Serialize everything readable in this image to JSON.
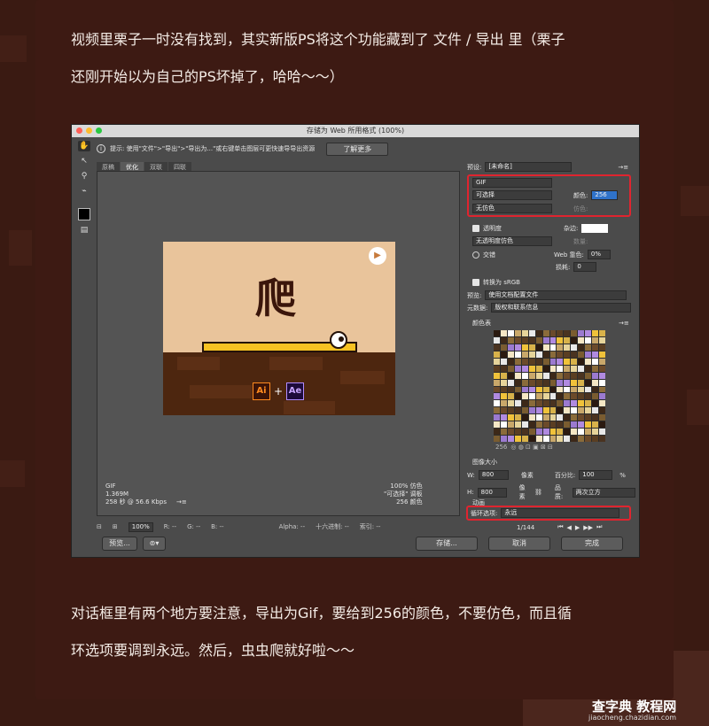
{
  "article": {
    "intro_line1": "视频里栗子一时没有找到，其实新版PS将这个功能藏到了 文件 / 导出 里（栗子",
    "intro_line2": "还刚开始以为自己的PS坏掉了，哈哈～～）",
    "outro_line1": "对话框里有两个地方要注意，导出为Gif，要给到256的颜色，不要仿色，而且循",
    "outro_line2": "环选项要调到永远。然后，虫虫爬就好啦～～"
  },
  "dialog": {
    "title": "存储为 Web 所用格式 (100%)",
    "tip": "提示: 使用\"文件\">\"导出\">\"导出为...\"或右键单击图层可更快速导导出资源",
    "learn_more": "了解更多",
    "view_tabs": [
      "原稿",
      "优化",
      "双联",
      "四联"
    ],
    "active_tab_index": 1,
    "preview": {
      "character": "爬",
      "logo_ai": "Ai",
      "logo_ae": "Ae",
      "plus": "+"
    },
    "stats_left": [
      "GIF",
      "1.369M",
      "258 秒 @ 56.6 Kbps",
      "→≡"
    ],
    "stats_right": [
      "100% 仿色",
      "\"可选择\" 调板",
      "256 颜色"
    ],
    "statusbar": [
      "100%",
      "R: --",
      "G: --",
      "B: --",
      "Alpha: --",
      "十六进制: --",
      "索引: --"
    ],
    "buttons": {
      "preview": "预览...",
      "save": "存储...",
      "cancel": "取消",
      "done": "完成"
    }
  },
  "settings": {
    "preset_label": "预设:",
    "preset_value": "[未命名]",
    "format": "GIF",
    "reduction": "可选择",
    "colors_label": "颜色:",
    "colors_value": "256",
    "dither": "无仿色",
    "dither_label": "仿色:",
    "transparency_label": "透明度",
    "matte_label": "杂边:",
    "transparency_dither": "无透明度仿色",
    "amount_label": "数量:",
    "interlaced_label": "交错",
    "web_snap_label": "Web 靠色:",
    "web_snap_value": "0%",
    "lossy_label": "损耗:",
    "lossy_value": "0",
    "convert_srgb": "转换为 sRGB",
    "preview_label": "预览:",
    "preview_value": "使用文档配置文件",
    "metadata_label": "元数据:",
    "metadata_value": "版权和联系信息",
    "color_table_label": "颜色表",
    "color_count": "256",
    "image_size_label": "图像大小",
    "w_label": "W:",
    "w_value": "800",
    "h_label": "H:",
    "h_value": "800",
    "px": "像素",
    "percent_label": "百分比:",
    "percent_value": "100",
    "percent_unit": "%",
    "quality_label": "品质:",
    "quality_value": "两次立方",
    "animation_label": "动画",
    "loop_label": "循环选项:",
    "loop_value": "永远",
    "frame_counter": "1/144",
    "highlight_color": "#e0242f"
  },
  "palette": [
    "#2b1a10",
    "#8a6b3a",
    "#f0c23a",
    "#e8e8e8",
    "#9b7ad0",
    "#c9a86a",
    "#4a3320",
    "#f5e7c5",
    "#6b4a2a",
    "#d8b24a",
    "#3c2818",
    "#b08ae0",
    "#e6d49a",
    "#7a5c30",
    "#ffffff",
    "#5a3e22"
  ],
  "watermark": {
    "site": "查字典 教程网",
    "url": "jiaocheng.chazidian.com"
  }
}
